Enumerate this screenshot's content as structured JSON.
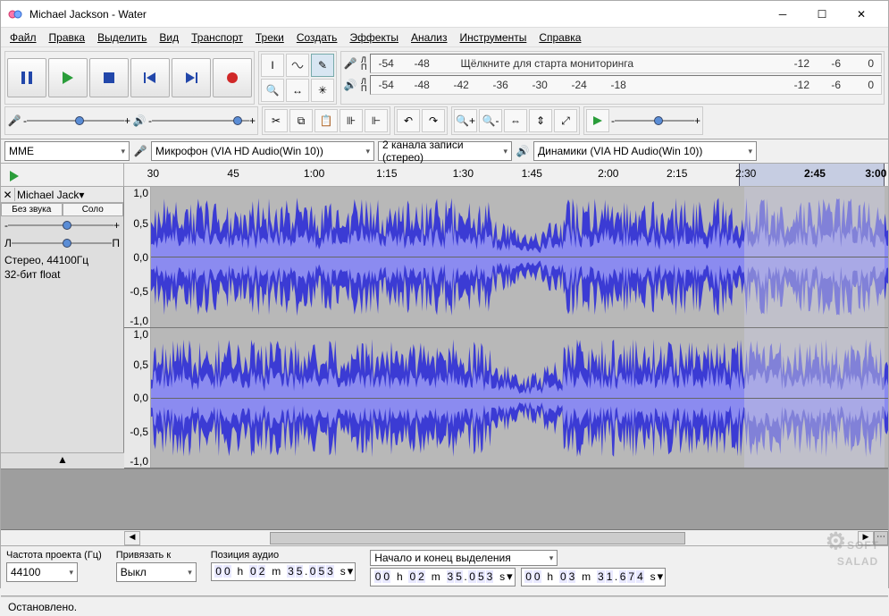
{
  "window": {
    "title": "Michael Jackson - Water"
  },
  "menu": [
    "Файл",
    "Правка",
    "Выделить",
    "Вид",
    "Транспорт",
    "Треки",
    "Создать",
    "Эффекты",
    "Анализ",
    "Инструменты",
    "Справка"
  ],
  "transport": {
    "pause": "⏸",
    "play": "▶",
    "stop": "■",
    "skip_start": "⏮",
    "skip_end": "⏭",
    "record": "●"
  },
  "meter": {
    "rec_hint": "Щёлкните для старта мониторинга",
    "ticks": [
      "-54",
      "-48",
      "-42",
      "-36",
      "-30",
      "-24",
      "-18",
      "-12",
      "-6",
      "0"
    ]
  },
  "devices": {
    "host": "MME",
    "input": "Микрофон (VIA HD Audio(Win 10))",
    "channels": "2 канала записи (стерео)",
    "output": "Динамики (VIA HD Audio(Win 10))"
  },
  "timeline": {
    "labels": [
      "30",
      "45",
      "1:00",
      "1:15",
      "1:30",
      "1:45",
      "2:00",
      "2:15",
      "2:30",
      "2:45",
      "3:00"
    ]
  },
  "track": {
    "name": "Michael Jack",
    "mute": "Без звука",
    "solo": "Соло",
    "gain_left": "-",
    "gain_right": "+",
    "pan_left": "Л",
    "pan_right": "П",
    "format_line1": "Стерео, 44100Гц",
    "format_line2": "32-бит float",
    "scale": [
      "1,0",
      "0,5",
      "0,0",
      "-0,5",
      "-1,0"
    ],
    "collapse": "▲"
  },
  "bottom": {
    "rate_label": "Частота проекта (Гц)",
    "rate_value": "44100",
    "snap_label": "Привязать к",
    "snap_value": "Выкл",
    "pos_label": "Позиция аудио",
    "sel_label": "Начало и конец выделения",
    "pos_value": "00 h 02 m 35.053 s",
    "sel_start": "00 h 02 m 35.053 s",
    "sel_end": "00 h 03 m 31.674 s"
  },
  "status": {
    "text": "Остановлено."
  },
  "watermark": {
    "l1": "SOFT",
    "l2": "SALAD"
  }
}
